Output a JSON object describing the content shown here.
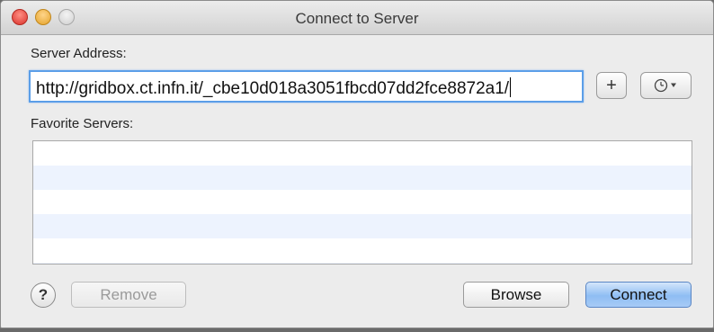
{
  "window": {
    "title": "Connect to Server"
  },
  "server_address": {
    "label": "Server Address:",
    "value": "http://gridbox.ct.infn.it/_cbe10d018a3051fbcd07dd2fce8872a1/"
  },
  "toolbar": {
    "add_label": "+"
  },
  "favorites": {
    "label": "Favorite Servers:",
    "items": []
  },
  "footer": {
    "help_label": "?",
    "remove_label": "Remove",
    "browse_label": "Browse",
    "connect_label": "Connect"
  },
  "colors": {
    "accent": "#5b9ee8",
    "default_button": "#8fbdf3",
    "list_stripe": "#edf3fe"
  }
}
